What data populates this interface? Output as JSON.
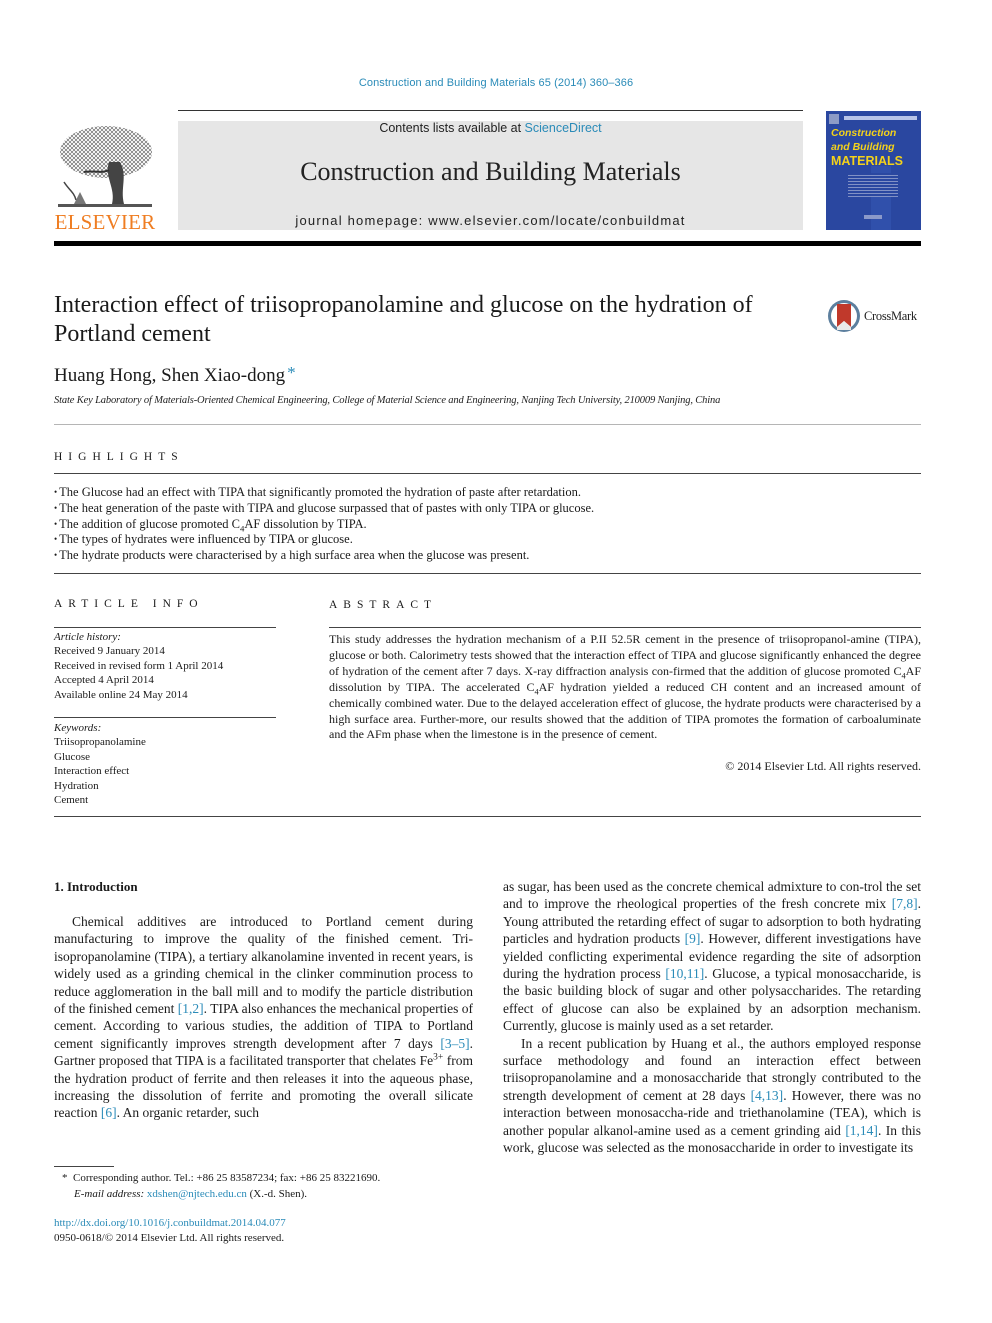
{
  "header": {
    "journal_reference": "Construction and Building Materials 65 (2014) 360–366",
    "contents_prefix": "Contents lists available at ",
    "contents_link": "ScienceDirect",
    "journal_title": "Construction and Building Materials",
    "homepage_line": "journal homepage: www.elsevier.com/locate/conbuildmat",
    "publisher_logo_text": "ELSEVIER",
    "cover": {
      "line1": "Construction",
      "line2": "and Building",
      "line3": "MATERIALS"
    },
    "colors": {
      "link": "#2a8bb8",
      "elsevier_orange": "#ef7d22",
      "cover_blue": "#2a47a0",
      "cover_yellow": "#f4d21a",
      "masthead_grey": "#e6e6e6"
    }
  },
  "article": {
    "title": "Interaction effect of triisopropanolamine and glucose on the hydration of Portland cement",
    "crossmark_label": "CrossMark",
    "authors": "Huang Hong, Shen Xiao-dong",
    "corresponding_marker": "*",
    "affiliation": "State Key Laboratory of Materials-Oriented Chemical Engineering, College of Material Science and Engineering, Nanjing Tech University, 210009 Nanjing, China"
  },
  "highlights": {
    "heading": "HIGHLIGHTS",
    "items": [
      {
        "pre": "The Glucose had an effect with TIPA that significantly promoted the hydration of paste after retardation.",
        "sub": "",
        "post": ""
      },
      {
        "pre": "The heat generation of the paste with TIPA and glucose surpassed that of pastes with only TIPA or glucose.",
        "sub": "",
        "post": ""
      },
      {
        "pre": "The addition of glucose promoted C",
        "sub": "4",
        "post": "AF dissolution by TIPA."
      },
      {
        "pre": "The types of hydrates were influenced by TIPA or glucose.",
        "sub": "",
        "post": ""
      },
      {
        "pre": "The hydrate products were characterised by a high surface area when the glucose was present.",
        "sub": "",
        "post": ""
      }
    ]
  },
  "article_info": {
    "heading": "ARTICLE INFO",
    "history_label": "Article history:",
    "history": [
      "Received 9 January 2014",
      "Received in revised form 1 April 2014",
      "Accepted 4 April 2014",
      "Available online 24 May 2014"
    ],
    "keywords_label": "Keywords:",
    "keywords": [
      "Triisopropanolamine",
      "Glucose",
      "Interaction effect",
      "Hydration",
      "Cement"
    ]
  },
  "abstract": {
    "heading": "ABSTRACT",
    "part1": "This study addresses the hydration mechanism of a P.II 52.5R cement in the presence of triisopropanol-amine (TIPA), glucose or both. Calorimetry tests showed that the interaction effect of TIPA and glucose significantly enhanced the degree of hydration of the cement after 7 days. X-ray diffraction analysis con-firmed that the addition of glucose promoted C",
    "sub1": "4",
    "part2": "AF dissolution by TIPA. The accelerated C",
    "sub2": "4",
    "part3": "AF hydration yielded a reduced CH content and an increased amount of chemically combined water. Due to the delayed acceleration effect of glucose, the hydrate products were characterised by a high surface area. Further-more, our results showed that the addition of TIPA promotes the formation of carboaluminate and the AFm phase when the limestone is in the presence of cement.",
    "copyright": "© 2014 Elsevier Ltd. All rights reserved."
  },
  "body": {
    "section_heading": "1. Introduction",
    "left": {
      "t1": "Chemical additives are introduced to Portland cement during manufacturing to improve the quality of the finished cement. Tri-isopropanolamine (TIPA), a tertiary alkanolamine invented in recent years, is widely used as a grinding chemical in the clinker comminution process to reduce agglomeration in the ball mill and to modify the particle distribution of the finished cement ",
      "r1": "[1,2]",
      "t2": ". TIPA also enhances the mechanical properties of cement. According to various studies, the addition of TIPA to Portland cement significantly improves strength development after 7 days ",
      "r2": "[3–5]",
      "t3": ". Gartner proposed that TIPA is a facilitated transporter that chelates Fe",
      "sup": "3+",
      "t4": " from the hydration product of ferrite and then releases it into the aqueous phase, increasing the dissolution of ferrite and promoting the overall silicate reaction ",
      "r3": "[6]",
      "t5": ". An organic retarder, such"
    },
    "right_p1": {
      "t1": "as sugar, has been used as the concrete chemical admixture to con-trol the set and to improve the rheological properties of the fresh concrete mix ",
      "r1": "[7,8]",
      "t2": ". Young attributed the retarding effect of sugar to adsorption to both hydrating particles and hydration products ",
      "r2": "[9]",
      "t3": ". However, different investigations have yielded conflicting experimental evidence regarding the site of adsorption during the hydration process ",
      "r3": "[10,11]",
      "t4": ". Glucose, a typical monosaccharide, is the basic building block of sugar and other polysaccharides. The retarding effect of glucose can also be explained by an adsorption mechanism. Currently, glucose is mainly used as a set retarder."
    },
    "right_p2": {
      "t1": "In a recent publication by Huang et al., the authors employed response surface methodology and found an interaction effect between triisopropanolamine and a monosaccharide that strongly contributed to the strength development of cement at 28 days ",
      "r1": "[4,13]",
      "t2": ". However, there was no interaction between monosaccha-ride and triethanolamine (TEA), which is another popular alkanol-amine used as a cement grinding aid ",
      "r2": "[1,14]",
      "t3": ". In this work, glucose was selected as the monosaccharide in order to investigate its"
    }
  },
  "footnote": {
    "marker": "*",
    "corresponding": "Corresponding author. Tel.: +86 25 83587234; fax: +86 25 83221690.",
    "email_label": "E-mail address:",
    "email": "xdshen@njtech.edu.cn",
    "email_suffix": "(X.-d. Shen)."
  },
  "doi": {
    "url": "http://dx.doi.org/10.1016/j.conbuildmat.2014.04.077",
    "issn_line": "0950-0618/© 2014 Elsevier Ltd. All rights reserved."
  }
}
